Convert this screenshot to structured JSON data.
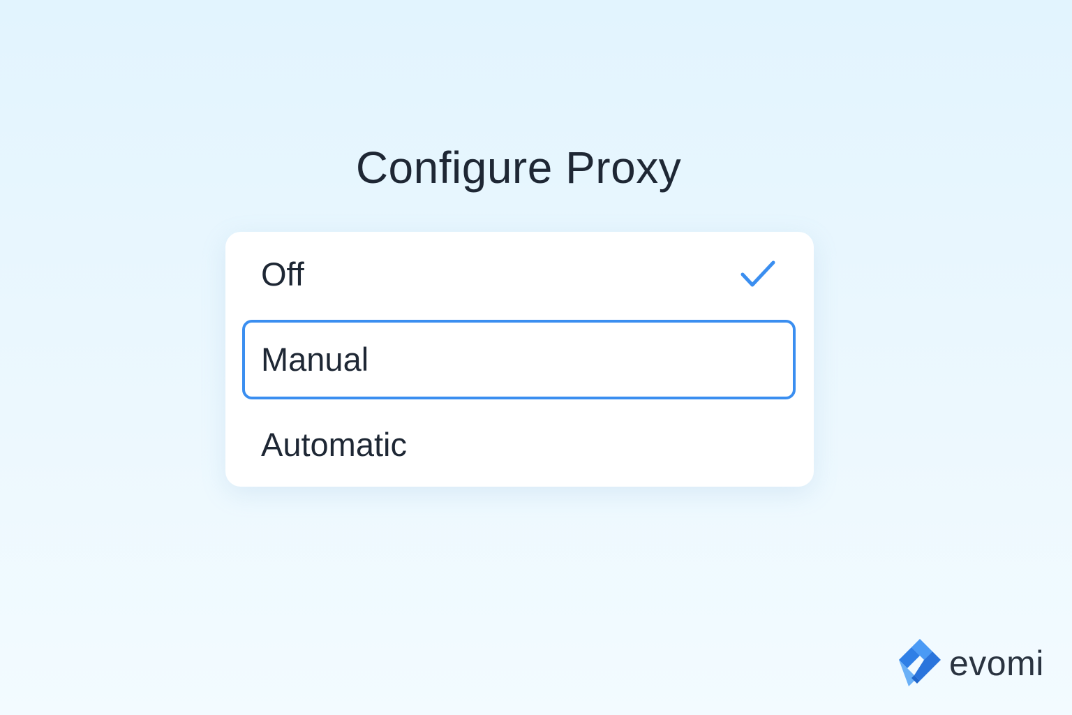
{
  "page": {
    "title": "Configure Proxy"
  },
  "options": [
    {
      "label": "Off",
      "checked": true,
      "focused": false
    },
    {
      "label": "Manual",
      "checked": false,
      "focused": true
    },
    {
      "label": "Automatic",
      "checked": false,
      "focused": false
    }
  ],
  "icons": {
    "checkmark": "check-icon",
    "brand_logo": "evomi-logo-icon"
  },
  "brand": {
    "name": "evomi"
  },
  "colors": {
    "accent": "#3a8ef0",
    "text": "#1e2734",
    "background_top": "#e2f4fe",
    "background_bottom": "#f3fbff",
    "card": "#ffffff"
  }
}
